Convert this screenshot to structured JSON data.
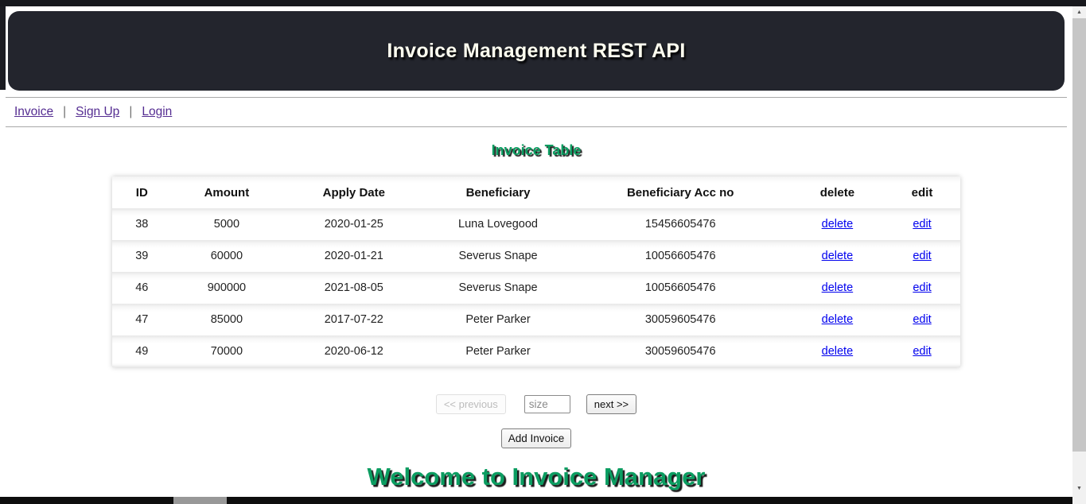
{
  "header": {
    "title": "Invoice Management REST API",
    "bg_color": "#23252d",
    "text_color": "#fffff0"
  },
  "nav": {
    "separator": "|",
    "link_color": "#542c91",
    "items": [
      {
        "label": "Invoice"
      },
      {
        "label": "Sign Up"
      },
      {
        "label": "Login"
      }
    ]
  },
  "invoice_table": {
    "heading": "Invoice Table",
    "accent_color": "#0b9d61",
    "link_color": "#0000ee",
    "columns": [
      "ID",
      "Amount",
      "Apply Date",
      "Beneficiary",
      "Beneficiary Acc no",
      "delete",
      "edit"
    ],
    "rows": [
      {
        "id": "38",
        "amount": "5000",
        "apply_date": "2020-01-25",
        "beneficiary": "Luna Lovegood",
        "acc_no": "15456605476",
        "delete": "delete",
        "edit": "edit"
      },
      {
        "id": "39",
        "amount": "60000",
        "apply_date": "2020-01-21",
        "beneficiary": "Severus Snape",
        "acc_no": "10056605476",
        "delete": "delete",
        "edit": "edit"
      },
      {
        "id": "46",
        "amount": "900000",
        "apply_date": "2021-08-05",
        "beneficiary": "Severus Snape",
        "acc_no": "10056605476",
        "delete": "delete",
        "edit": "edit"
      },
      {
        "id": "47",
        "amount": "85000",
        "apply_date": "2017-07-22",
        "beneficiary": "Peter Parker",
        "acc_no": "30059605476",
        "delete": "delete",
        "edit": "edit"
      },
      {
        "id": "49",
        "amount": "70000",
        "apply_date": "2020-06-12",
        "beneficiary": "Peter Parker",
        "acc_no": "30059605476",
        "delete": "delete",
        "edit": "edit"
      }
    ]
  },
  "pagination": {
    "previous_label": "<< previous",
    "size_placeholder": "size",
    "next_label": "next >>"
  },
  "actions": {
    "add_invoice_label": "Add Invoice"
  },
  "welcome": {
    "heading": "Welcome to Invoice Manager"
  },
  "scrollbar": {
    "up_icon": "▲",
    "down_icon": "▼"
  }
}
